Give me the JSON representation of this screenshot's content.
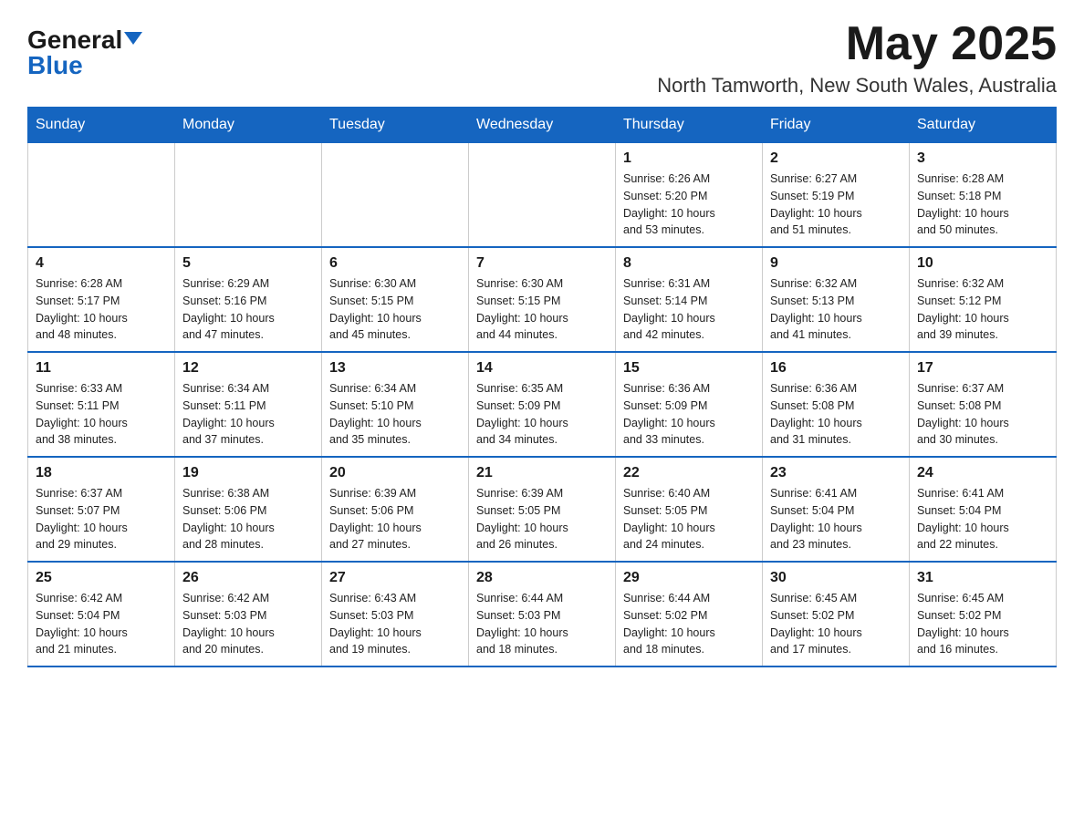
{
  "logo": {
    "general": "General",
    "blue": "Blue"
  },
  "title": {
    "month_year": "May 2025",
    "location": "North Tamworth, New South Wales, Australia"
  },
  "weekdays": [
    "Sunday",
    "Monday",
    "Tuesday",
    "Wednesday",
    "Thursday",
    "Friday",
    "Saturday"
  ],
  "weeks": [
    [
      {
        "day": "",
        "info": ""
      },
      {
        "day": "",
        "info": ""
      },
      {
        "day": "",
        "info": ""
      },
      {
        "day": "",
        "info": ""
      },
      {
        "day": "1",
        "info": "Sunrise: 6:26 AM\nSunset: 5:20 PM\nDaylight: 10 hours\nand 53 minutes."
      },
      {
        "day": "2",
        "info": "Sunrise: 6:27 AM\nSunset: 5:19 PM\nDaylight: 10 hours\nand 51 minutes."
      },
      {
        "day": "3",
        "info": "Sunrise: 6:28 AM\nSunset: 5:18 PM\nDaylight: 10 hours\nand 50 minutes."
      }
    ],
    [
      {
        "day": "4",
        "info": "Sunrise: 6:28 AM\nSunset: 5:17 PM\nDaylight: 10 hours\nand 48 minutes."
      },
      {
        "day": "5",
        "info": "Sunrise: 6:29 AM\nSunset: 5:16 PM\nDaylight: 10 hours\nand 47 minutes."
      },
      {
        "day": "6",
        "info": "Sunrise: 6:30 AM\nSunset: 5:15 PM\nDaylight: 10 hours\nand 45 minutes."
      },
      {
        "day": "7",
        "info": "Sunrise: 6:30 AM\nSunset: 5:15 PM\nDaylight: 10 hours\nand 44 minutes."
      },
      {
        "day": "8",
        "info": "Sunrise: 6:31 AM\nSunset: 5:14 PM\nDaylight: 10 hours\nand 42 minutes."
      },
      {
        "day": "9",
        "info": "Sunrise: 6:32 AM\nSunset: 5:13 PM\nDaylight: 10 hours\nand 41 minutes."
      },
      {
        "day": "10",
        "info": "Sunrise: 6:32 AM\nSunset: 5:12 PM\nDaylight: 10 hours\nand 39 minutes."
      }
    ],
    [
      {
        "day": "11",
        "info": "Sunrise: 6:33 AM\nSunset: 5:11 PM\nDaylight: 10 hours\nand 38 minutes."
      },
      {
        "day": "12",
        "info": "Sunrise: 6:34 AM\nSunset: 5:11 PM\nDaylight: 10 hours\nand 37 minutes."
      },
      {
        "day": "13",
        "info": "Sunrise: 6:34 AM\nSunset: 5:10 PM\nDaylight: 10 hours\nand 35 minutes."
      },
      {
        "day": "14",
        "info": "Sunrise: 6:35 AM\nSunset: 5:09 PM\nDaylight: 10 hours\nand 34 minutes."
      },
      {
        "day": "15",
        "info": "Sunrise: 6:36 AM\nSunset: 5:09 PM\nDaylight: 10 hours\nand 33 minutes."
      },
      {
        "day": "16",
        "info": "Sunrise: 6:36 AM\nSunset: 5:08 PM\nDaylight: 10 hours\nand 31 minutes."
      },
      {
        "day": "17",
        "info": "Sunrise: 6:37 AM\nSunset: 5:08 PM\nDaylight: 10 hours\nand 30 minutes."
      }
    ],
    [
      {
        "day": "18",
        "info": "Sunrise: 6:37 AM\nSunset: 5:07 PM\nDaylight: 10 hours\nand 29 minutes."
      },
      {
        "day": "19",
        "info": "Sunrise: 6:38 AM\nSunset: 5:06 PM\nDaylight: 10 hours\nand 28 minutes."
      },
      {
        "day": "20",
        "info": "Sunrise: 6:39 AM\nSunset: 5:06 PM\nDaylight: 10 hours\nand 27 minutes."
      },
      {
        "day": "21",
        "info": "Sunrise: 6:39 AM\nSunset: 5:05 PM\nDaylight: 10 hours\nand 26 minutes."
      },
      {
        "day": "22",
        "info": "Sunrise: 6:40 AM\nSunset: 5:05 PM\nDaylight: 10 hours\nand 24 minutes."
      },
      {
        "day": "23",
        "info": "Sunrise: 6:41 AM\nSunset: 5:04 PM\nDaylight: 10 hours\nand 23 minutes."
      },
      {
        "day": "24",
        "info": "Sunrise: 6:41 AM\nSunset: 5:04 PM\nDaylight: 10 hours\nand 22 minutes."
      }
    ],
    [
      {
        "day": "25",
        "info": "Sunrise: 6:42 AM\nSunset: 5:04 PM\nDaylight: 10 hours\nand 21 minutes."
      },
      {
        "day": "26",
        "info": "Sunrise: 6:42 AM\nSunset: 5:03 PM\nDaylight: 10 hours\nand 20 minutes."
      },
      {
        "day": "27",
        "info": "Sunrise: 6:43 AM\nSunset: 5:03 PM\nDaylight: 10 hours\nand 19 minutes."
      },
      {
        "day": "28",
        "info": "Sunrise: 6:44 AM\nSunset: 5:03 PM\nDaylight: 10 hours\nand 18 minutes."
      },
      {
        "day": "29",
        "info": "Sunrise: 6:44 AM\nSunset: 5:02 PM\nDaylight: 10 hours\nand 18 minutes."
      },
      {
        "day": "30",
        "info": "Sunrise: 6:45 AM\nSunset: 5:02 PM\nDaylight: 10 hours\nand 17 minutes."
      },
      {
        "day": "31",
        "info": "Sunrise: 6:45 AM\nSunset: 5:02 PM\nDaylight: 10 hours\nand 16 minutes."
      }
    ]
  ]
}
